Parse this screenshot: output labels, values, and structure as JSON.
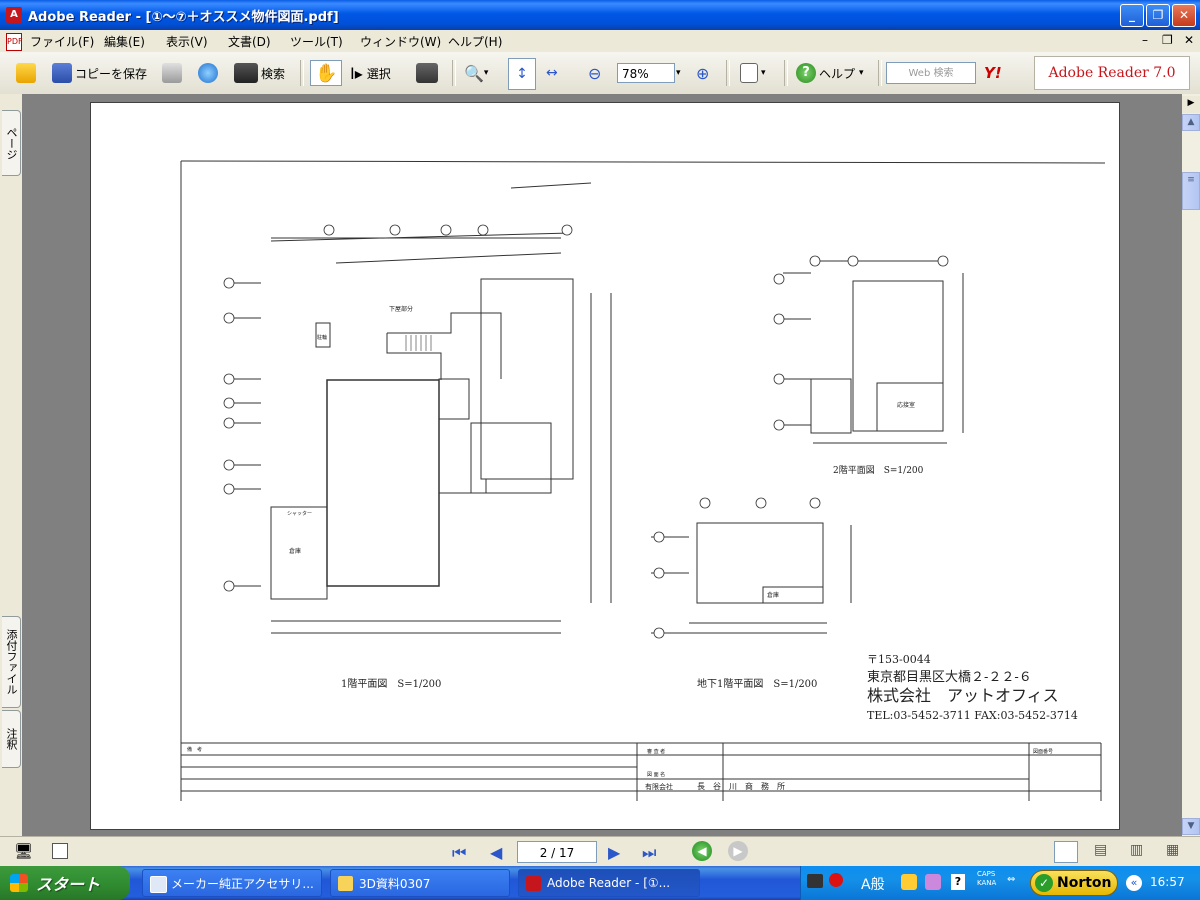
{
  "window": {
    "title": "Adobe Reader - [①～⑦＋オススメ物件図面.pdf]"
  },
  "menu": {
    "items": [
      "ファイル(F)",
      "編集(E)",
      "表示(V)",
      "文書(D)",
      "ツール(T)",
      "ウィンドウ(W)",
      "ヘルプ(H)"
    ]
  },
  "toolbar": {
    "save_copy_label": "コピーを保存",
    "search_label": "検索",
    "select_label": "選択",
    "zoom_value": "78%",
    "help_label": "ヘルプ",
    "web_search_placeholder": "Web 検索",
    "brand": "Adobe Reader 7.0"
  },
  "left_tabs": {
    "pages": "ページ",
    "attachments": "添付ファイル",
    "comments": "注釈"
  },
  "navigation": {
    "page_display": "2 / 17"
  },
  "drawing": {
    "plan_1f": {
      "title": "1階平面図　S=1/200"
    },
    "plan_2f": {
      "title": "2階平面図　S=1/200"
    },
    "plan_b1": {
      "title": "地下1階平面図　S=1/200"
    },
    "company": {
      "postal": "〒153-0044",
      "address": "東京都目黒区大橋２-２２-６",
      "name": "株式会社　アットオフィス",
      "phone": "TEL:03-5452-3711  FAX:03-5452-3714"
    },
    "rooms": {
      "stair_label": "下屋部分",
      "office_2f": "応接室",
      "warehouse": "倉庫",
      "shutter": "シャッター",
      "storage": "倉庫",
      "parking": "駐輪"
    },
    "titleblock": {
      "company_label": "有限会社",
      "company_name": "長　谷　川　商　務　所",
      "review": "審 査 者",
      "drawer": "図 面 名",
      "number": "図面番号",
      "memo": "備　考"
    }
  },
  "taskbar": {
    "start": "スタート",
    "tasks": [
      "メーカー純正アクセサリ...",
      "3D資料0307",
      "Adobe Reader - [①..."
    ],
    "norton": "Norton",
    "ime": "A般",
    "clock": "16:57"
  },
  "colors": {
    "titlebar": "#0054e3",
    "taskbar": "#245edc",
    "start": "#3c9a3c",
    "adobe_red": "#c4161c"
  }
}
